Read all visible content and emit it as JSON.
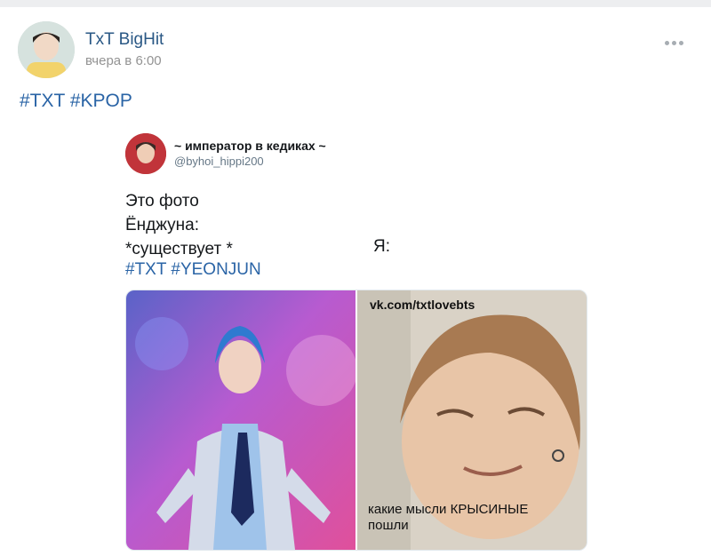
{
  "post": {
    "author": "TxT BigHit",
    "time": "вчера в 6:00",
    "hashtags": [
      "#TXT",
      "#KPOP"
    ]
  },
  "tweet": {
    "display_name": "~ император в кедиках ~",
    "handle": "@byhoi_hippi200",
    "lines": [
      "Это фото",
      "Ёнджуна:",
      "*существует *"
    ],
    "reply_label": "Я:",
    "hashtags": [
      "#TXT",
      "#YEONJUN"
    ]
  },
  "meme": {
    "watermark": "vk.com/txtlovebts",
    "caption_lines": [
      "какие мысли КРЫСИНЫЕ",
      "пошли"
    ]
  },
  "icons": {
    "more": "more-dots-icon"
  },
  "colors": {
    "link": "#2a64a6",
    "author": "#2a5885",
    "muted": "#939393"
  }
}
